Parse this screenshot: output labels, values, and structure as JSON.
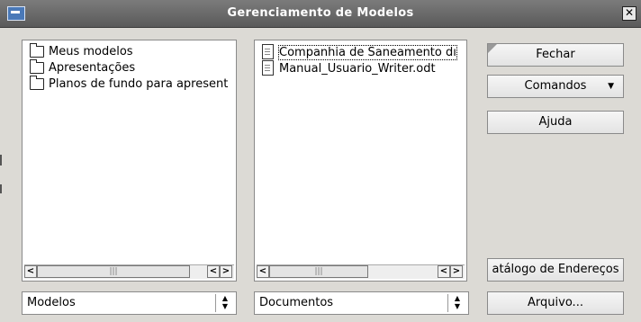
{
  "window": {
    "title": "Gerenciamento de Modelos"
  },
  "left_list": {
    "items": [
      "Meus modelos",
      "Apresentações",
      "Planos de fundo para apresent"
    ],
    "scroll_thumb": "|||"
  },
  "right_list": {
    "items": [
      "Companhia de Saneamento dı",
      "Manual_Usuario_Writer.odt"
    ],
    "scroll_thumb": "|||"
  },
  "left_combo": {
    "value": "Modelos"
  },
  "right_combo": {
    "value": "Documentos"
  },
  "buttons": {
    "close": "Fechar",
    "commands": "Comandos",
    "help": "Ajuda",
    "address_book": "atálogo de Endereços",
    "file": "Arquivo..."
  }
}
